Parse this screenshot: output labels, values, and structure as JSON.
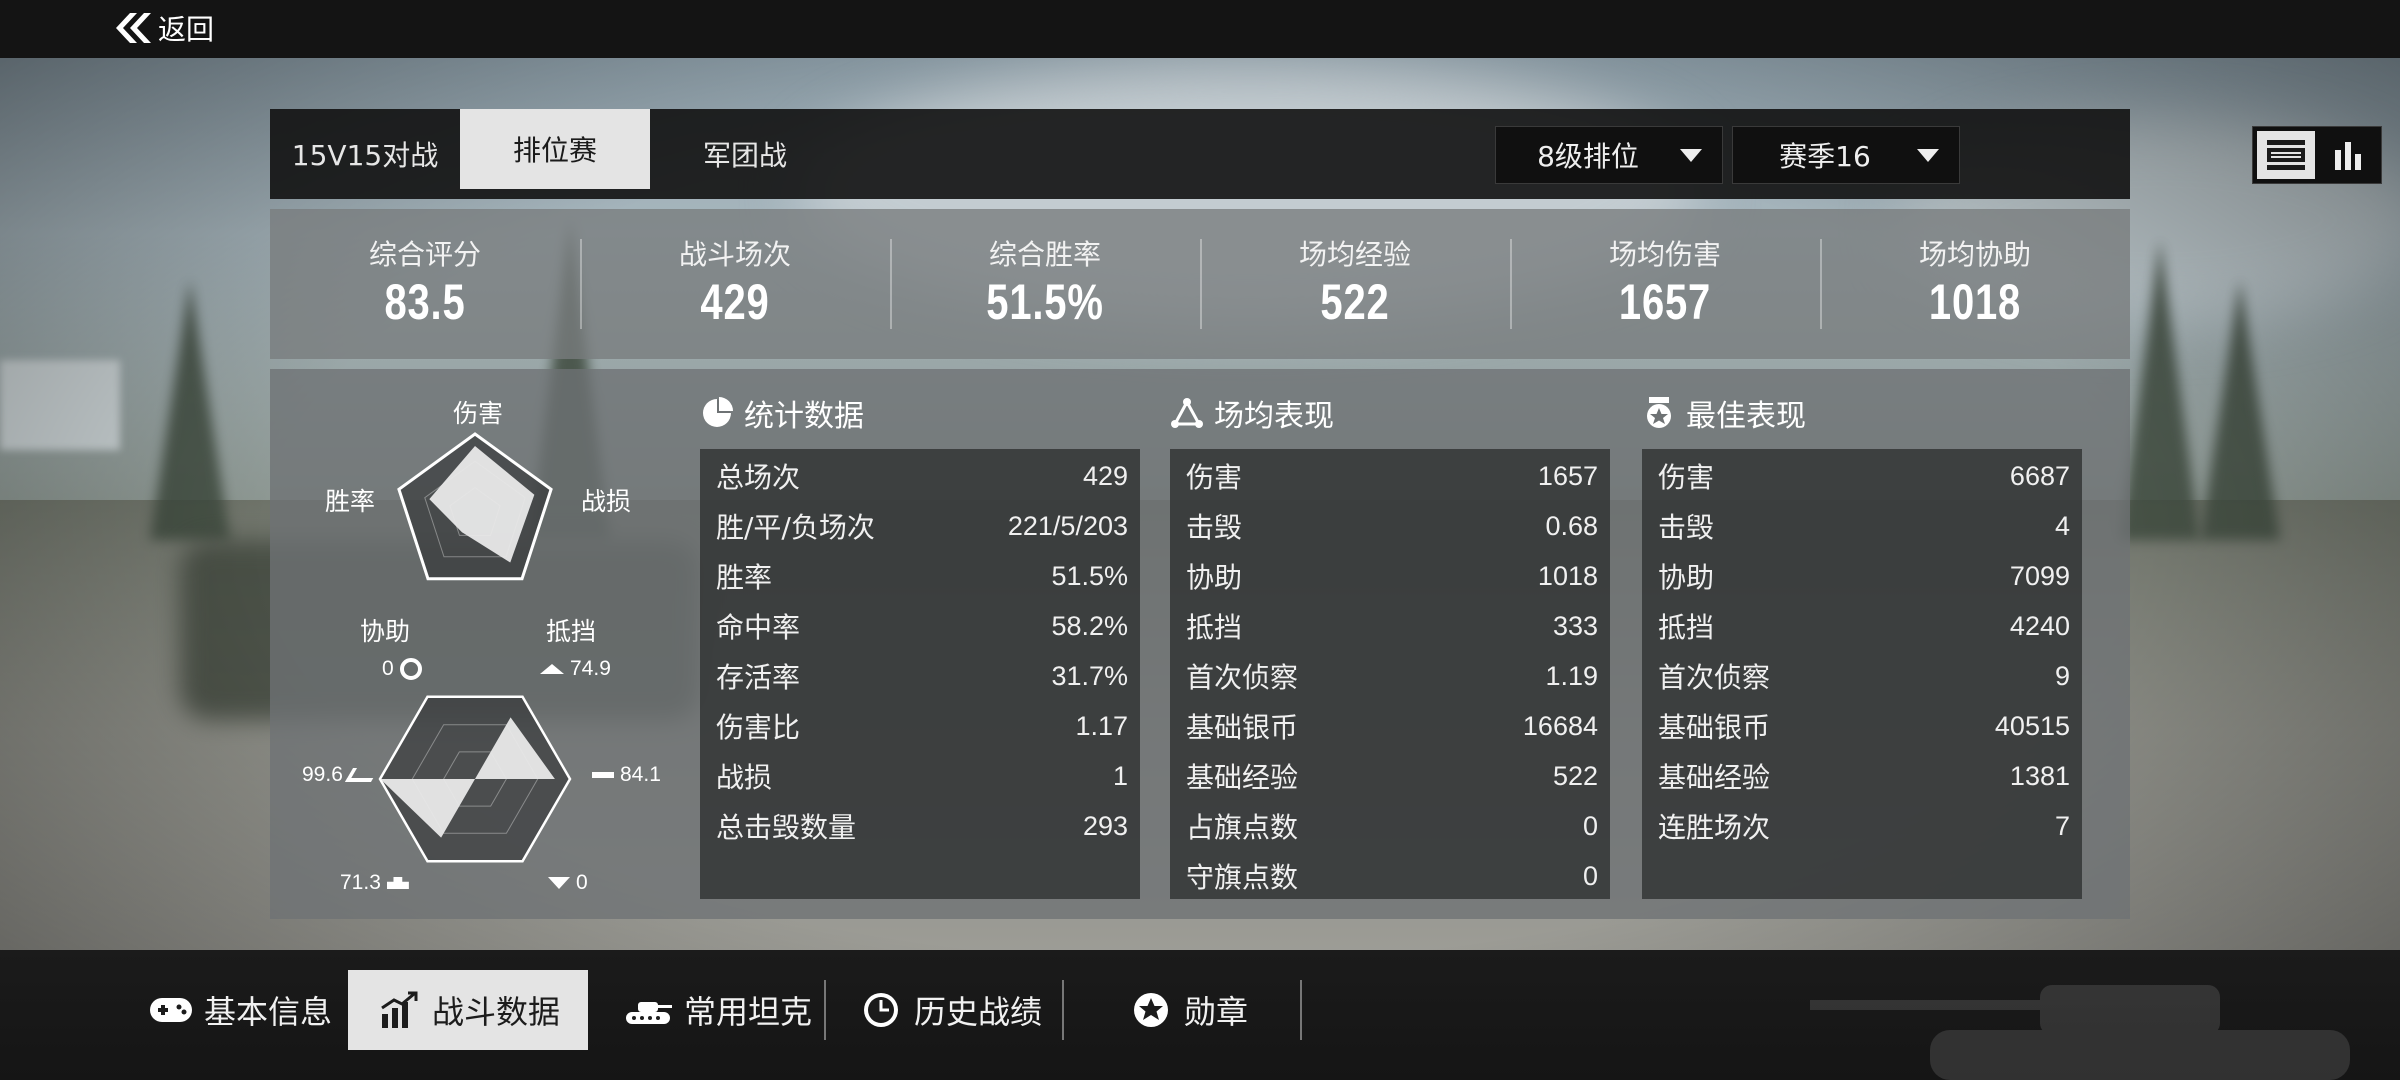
{
  "header": {
    "back_label": "返回"
  },
  "mode_tabs": [
    "15V15对战",
    "排位赛",
    "军团战"
  ],
  "active_mode_tab": "排位赛",
  "filters": {
    "tier": "8级排位",
    "season": "赛季16"
  },
  "summary": [
    {
      "label": "综合评分",
      "value": "83.5"
    },
    {
      "label": "战斗场次",
      "value": "429"
    },
    {
      "label": "综合胜率",
      "value": "51.5%"
    },
    {
      "label": "场均经验",
      "value": "522"
    },
    {
      "label": "场均伤害",
      "value": "1657"
    },
    {
      "label": "场均协助",
      "value": "1018"
    }
  ],
  "radar": {
    "labels": {
      "top": "伤害",
      "right": "战损",
      "bottom_right": "抵挡",
      "bottom_left": "协助",
      "left": "胜率"
    },
    "values": {
      "伤害": 0.85,
      "战损": 0.78,
      "抵挡": 0.75,
      "协助": 0.28,
      "胜率": 0.6
    }
  },
  "hex": {
    "labels": {
      "top_left": "0",
      "top_right": "74.9",
      "right": "84.1",
      "bottom_right": "0",
      "bottom_left": "71.3",
      "left": "99.6"
    },
    "values": [
      0.0,
      0.749,
      0.841,
      0.0,
      0.713,
      0.996
    ]
  },
  "stats": {
    "title": "统计数据",
    "rows": [
      {
        "k": "总场次",
        "v": "429"
      },
      {
        "k": "胜/平/负场次",
        "v": "221/5/203"
      },
      {
        "k": "胜率",
        "v": "51.5%"
      },
      {
        "k": "命中率",
        "v": "58.2%"
      },
      {
        "k": "存活率",
        "v": "31.7%"
      },
      {
        "k": "伤害比",
        "v": "1.17"
      },
      {
        "k": "战损",
        "v": "1"
      },
      {
        "k": "总击毁数量",
        "v": "293"
      }
    ]
  },
  "average": {
    "title": "场均表现",
    "rows": [
      {
        "k": "伤害",
        "v": "1657"
      },
      {
        "k": "击毁",
        "v": "0.68"
      },
      {
        "k": "协助",
        "v": "1018"
      },
      {
        "k": "抵挡",
        "v": "333"
      },
      {
        "k": "首次侦察",
        "v": "1.19"
      },
      {
        "k": "基础银币",
        "v": "16684"
      },
      {
        "k": "基础经验",
        "v": "522"
      },
      {
        "k": "占旗点数",
        "v": "0"
      },
      {
        "k": "守旗点数",
        "v": "0"
      }
    ]
  },
  "best": {
    "title": "最佳表现",
    "rows": [
      {
        "k": "伤害",
        "v": "6687"
      },
      {
        "k": "击毁",
        "v": "4"
      },
      {
        "k": "协助",
        "v": "7099"
      },
      {
        "k": "抵挡",
        "v": "4240"
      },
      {
        "k": "首次侦察",
        "v": "9"
      },
      {
        "k": "基础银币",
        "v": "40515"
      },
      {
        "k": "基础经验",
        "v": "1381"
      },
      {
        "k": "连胜场次",
        "v": "7"
      }
    ]
  },
  "bottom_nav": [
    "基本信息",
    "战斗数据",
    "常用坦克",
    "历史战绩",
    "勋章"
  ],
  "active_bottom_nav": "战斗数据",
  "colors": {
    "active_tab_bg": "#e4e4e4",
    "panel_dark": "#141414"
  }
}
